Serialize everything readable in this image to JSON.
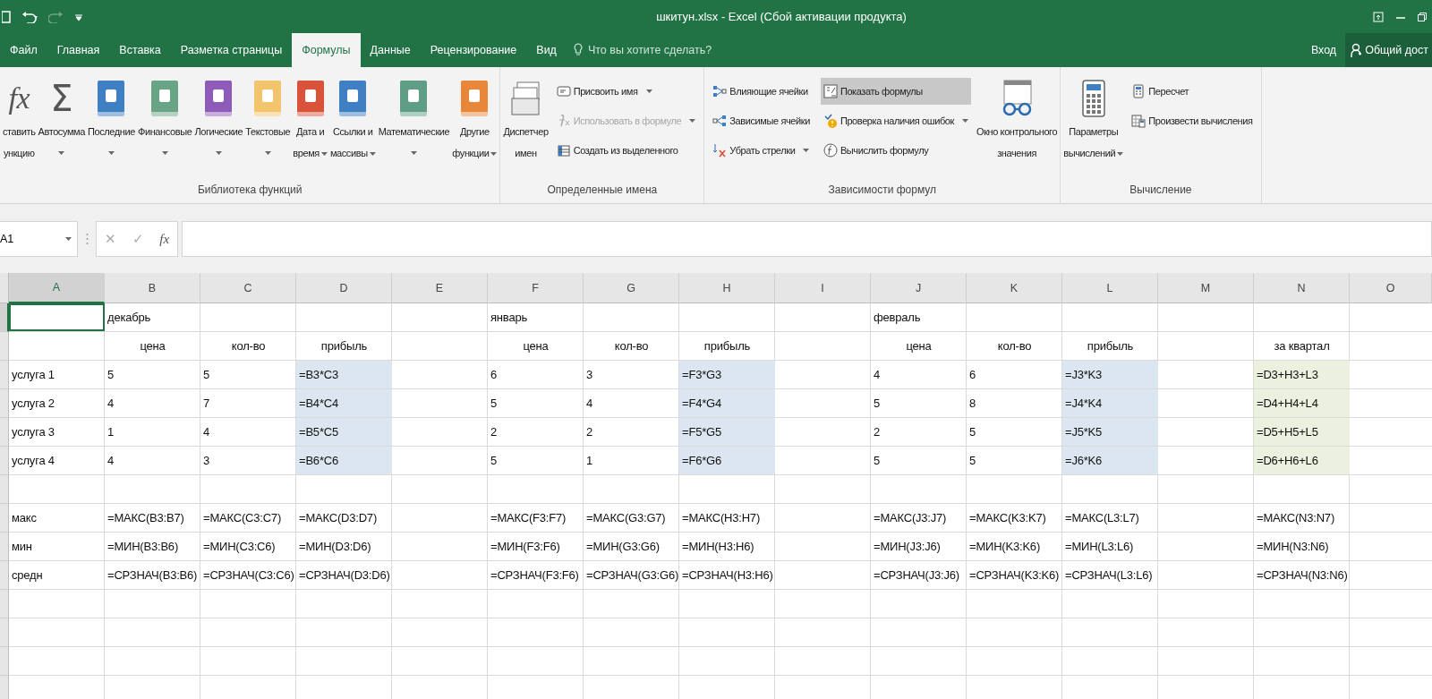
{
  "window": {
    "title": "шкитун.xlsx - Excel (Сбой активации продукта)"
  },
  "tabs": [
    {
      "label": "Файл",
      "selected": false
    },
    {
      "label": "Главная",
      "selected": false
    },
    {
      "label": "Вставка",
      "selected": false
    },
    {
      "label": "Разметка страницы",
      "selected": false
    },
    {
      "label": "Формулы",
      "selected": true
    },
    {
      "label": "Данные",
      "selected": false
    },
    {
      "label": "Рецензирование",
      "selected": false
    },
    {
      "label": "Вид",
      "selected": false
    }
  ],
  "tell_me": {
    "placeholder": "Что вы хотите сделать?"
  },
  "account": {
    "sign_in": "Вход",
    "share": "Общий дост"
  },
  "ribbon": {
    "groups": [
      {
        "label": "Библиотека функций",
        "items": [
          {
            "kind": "function",
            "glyph": "fx",
            "lines": [
              "ставить",
              "ункцию"
            ],
            "dropdown": false
          },
          {
            "kind": "sum",
            "glyph": "Σ",
            "lines": [
              "Автосумма"
            ],
            "dropdown": true
          },
          {
            "kind": "book",
            "color": "#3f7fc4",
            "lines": [
              "Последние"
            ],
            "dropdown": true
          },
          {
            "kind": "book",
            "color": "#6aa487",
            "lines": [
              "Финансовые"
            ],
            "dropdown": true
          },
          {
            "kind": "book",
            "color": "#8e5cb8",
            "lines": [
              "Логические"
            ],
            "dropdown": true
          },
          {
            "kind": "book",
            "color": "#f2c46b",
            "lines": [
              "Текстовые"
            ],
            "dropdown": true
          },
          {
            "kind": "book",
            "color": "#d9533b",
            "lines": [
              "Дата и",
              "время"
            ],
            "dropdown": true
          },
          {
            "kind": "book",
            "color": "#3f7fc4",
            "lines": [
              "Ссылки и",
              "массивы"
            ],
            "dropdown": true
          },
          {
            "kind": "book",
            "color": "#5e9e86",
            "lines": [
              "Математические"
            ],
            "dropdown": true
          },
          {
            "kind": "book",
            "color": "#e8873a",
            "lines": [
              "Другие",
              "функции"
            ],
            "dropdown": true
          }
        ]
      },
      {
        "label": "Определенные имена",
        "items": [
          {
            "kind": "manager",
            "lines": [
              "Диспетчер",
              "имен"
            ],
            "dropdown": false
          },
          {
            "kind": "stack",
            "items": [
              {
                "kind": "assign",
                "label": "Присвоить имя",
                "dropdown": true,
                "disabled": false,
                "selected": false
              },
              {
                "kind": "use",
                "label": "Использовать в формуле",
                "dropdown": true,
                "disabled": true,
                "selected": false
              },
              {
                "kind": "create",
                "label": "Создать из выделенного",
                "dropdown": false,
                "disabled": false,
                "selected": false
              }
            ]
          }
        ]
      },
      {
        "label": "Зависимости формул",
        "items": [
          {
            "kind": "stack",
            "items": [
              {
                "kind": "precedents",
                "label": "Влияющие ячейки",
                "dropdown": false,
                "disabled": false,
                "selected": false
              },
              {
                "kind": "dependents",
                "label": "Зависимые ячейки",
                "dropdown": false,
                "disabled": false,
                "selected": false
              },
              {
                "kind": "remove",
                "label": "Убрать стрелки",
                "dropdown": true,
                "disabled": false,
                "selected": false
              }
            ]
          },
          {
            "kind": "stack",
            "items": [
              {
                "kind": "show",
                "label": "Показать формулы",
                "dropdown": false,
                "disabled": false,
                "selected": true
              },
              {
                "kind": "check",
                "label": "Проверка наличия ошибок",
                "dropdown": true,
                "disabled": false,
                "selected": false
              },
              {
                "kind": "evaluate",
                "label": "Вычислить формулу",
                "dropdown": false,
                "disabled": false,
                "selected": false
              }
            ]
          },
          {
            "kind": "watch",
            "lines": [
              "Окно контрольного",
              "значения"
            ],
            "dropdown": false
          }
        ]
      },
      {
        "label": "Вычисление",
        "items": [
          {
            "kind": "calc",
            "lines": [
              "Параметры",
              "вычислений"
            ],
            "dropdown": true
          },
          {
            "kind": "stack",
            "items": [
              {
                "kind": "recalc",
                "label": "Пересчет",
                "dropdown": false,
                "disabled": false,
                "selected": false
              },
              {
                "kind": "compute",
                "label": "Произвести вычисления",
                "dropdown": false,
                "disabled": false,
                "selected": false
              }
            ]
          }
        ]
      }
    ]
  },
  "formula_bar": {
    "name_box": "A1",
    "cancel": "✕",
    "enter": "✓",
    "fx": "fx"
  },
  "grid": {
    "columns": [
      {
        "label": "A",
        "selected": true
      },
      {
        "label": "B",
        "selected": false
      },
      {
        "label": "C",
        "selected": false
      },
      {
        "label": "D",
        "selected": false
      },
      {
        "label": "E",
        "selected": false
      },
      {
        "label": "F",
        "selected": false
      },
      {
        "label": "G",
        "selected": false
      },
      {
        "label": "H",
        "selected": false
      },
      {
        "label": "I",
        "selected": false
      },
      {
        "label": "J",
        "selected": false
      },
      {
        "label": "K",
        "selected": false
      },
      {
        "label": "L",
        "selected": false
      },
      {
        "label": "M",
        "selected": false
      },
      {
        "label": "N",
        "selected": false
      },
      {
        "label": "O",
        "selected": false
      }
    ],
    "rows": [
      {
        "selected": true,
        "kind": "plain",
        "cells": [
          null,
          {
            "text": "декабрь"
          },
          null,
          null,
          null,
          {
            "text": "январь"
          },
          null,
          null,
          null,
          {
            "text": "февраль"
          },
          null,
          null,
          null,
          null,
          null
        ]
      },
      {
        "selected": false,
        "kind": "header",
        "cells": [
          null,
          {
            "text": "цена"
          },
          {
            "text": "кол-во"
          },
          {
            "text": "прибыль"
          },
          null,
          {
            "text": "цена"
          },
          {
            "text": "кол-во"
          },
          {
            "text": "прибыль"
          },
          null,
          {
            "text": "цена"
          },
          {
            "text": "кол-во"
          },
          {
            "text": "прибыль"
          },
          null,
          {
            "text": "за квартал"
          },
          null
        ]
      },
      {
        "selected": false,
        "kind": "plain",
        "cells": [
          {
            "text": "услуга 1"
          },
          {
            "text": "5"
          },
          {
            "text": "5"
          },
          {
            "text": "=B3*C3",
            "color": "#dce6f1"
          },
          null,
          {
            "text": "6"
          },
          {
            "text": "3"
          },
          {
            "text": "=F3*G3",
            "color": "#dce6f1"
          },
          null,
          {
            "text": "4"
          },
          {
            "text": "6"
          },
          {
            "text": "=J3*K3",
            "color": "#dce6f1"
          },
          null,
          {
            "text": "=D3+H3+L3",
            "color": "#ebf1de"
          },
          null
        ]
      },
      {
        "selected": false,
        "kind": "plain",
        "cells": [
          {
            "text": "услуга 2"
          },
          {
            "text": "4"
          },
          {
            "text": "7"
          },
          {
            "text": "=B4*C4",
            "color": "#dce6f1"
          },
          null,
          {
            "text": "5"
          },
          {
            "text": "4"
          },
          {
            "text": "=F4*G4",
            "color": "#dce6f1"
          },
          null,
          {
            "text": "5"
          },
          {
            "text": "8"
          },
          {
            "text": "=J4*K4",
            "color": "#dce6f1"
          },
          null,
          {
            "text": "=D4+H4+L4",
            "color": "#ebf1de"
          },
          null
        ]
      },
      {
        "selected": false,
        "kind": "plain",
        "cells": [
          {
            "text": "услуга 3"
          },
          {
            "text": "1"
          },
          {
            "text": "4"
          },
          {
            "text": "=B5*C5",
            "color": "#dce6f1"
          },
          null,
          {
            "text": "2"
          },
          {
            "text": "2"
          },
          {
            "text": "=F5*G5",
            "color": "#dce6f1"
          },
          null,
          {
            "text": "2"
          },
          {
            "text": "5"
          },
          {
            "text": "=J5*K5",
            "color": "#dce6f1"
          },
          null,
          {
            "text": "=D5+H5+L5",
            "color": "#ebf1de"
          },
          null
        ]
      },
      {
        "selected": false,
        "kind": "plain",
        "cells": [
          {
            "text": "услуга 4"
          },
          {
            "text": "4"
          },
          {
            "text": "3"
          },
          {
            "text": "=B6*C6",
            "color": "#dce6f1"
          },
          null,
          {
            "text": "5"
          },
          {
            "text": "1"
          },
          {
            "text": "=F6*G6",
            "color": "#dce6f1"
          },
          null,
          {
            "text": "5"
          },
          {
            "text": "5"
          },
          {
            "text": "=J6*K6",
            "color": "#dce6f1"
          },
          null,
          {
            "text": "=D6+H6+L6",
            "color": "#ebf1de"
          },
          null
        ]
      },
      {
        "selected": false,
        "kind": "plain",
        "cells": [
          null,
          null,
          null,
          null,
          null,
          null,
          null,
          null,
          null,
          null,
          null,
          null,
          null,
          null,
          null
        ]
      },
      {
        "selected": false,
        "kind": "plain",
        "cells": [
          {
            "text": "макс"
          },
          {
            "text": "=МАКС(B3:B7)"
          },
          {
            "text": "=МАКС(C3:C7)"
          },
          {
            "text": "=МАКС(D3:D7)"
          },
          null,
          {
            "text": "=МАКС(F3:F7)"
          },
          {
            "text": "=МАКС(G3:G7)"
          },
          {
            "text": "=МАКС(H3:H7)"
          },
          null,
          {
            "text": "=МАКС(J3:J7)"
          },
          {
            "text": "=МАКС(K3:K7)"
          },
          {
            "text": "=МАКС(L3:L7)"
          },
          null,
          {
            "text": "=МАКС(N3:N7)"
          },
          null
        ]
      },
      {
        "selected": false,
        "kind": "plain",
        "cells": [
          {
            "text": "мин"
          },
          {
            "text": "=МИН(B3:B6)"
          },
          {
            "text": "=МИН(C3:C6)"
          },
          {
            "text": "=МИН(D3:D6)"
          },
          null,
          {
            "text": "=МИН(F3:F6)"
          },
          {
            "text": "=МИН(G3:G6)"
          },
          {
            "text": "=МИН(H3:H6)"
          },
          null,
          {
            "text": "=МИН(J3:J6)"
          },
          {
            "text": "=МИН(K3:K6)"
          },
          {
            "text": "=МИН(L3:L6)"
          },
          null,
          {
            "text": "=МИН(N3:N6)"
          },
          null
        ]
      },
      {
        "selected": false,
        "kind": "plain",
        "cells": [
          {
            "text": "средн"
          },
          {
            "text": "=СРЗНАЧ(B3:B6)"
          },
          {
            "text": "=СРЗНАЧ(C3:C6)"
          },
          {
            "text": "=СРЗНАЧ(D3:D6)"
          },
          null,
          {
            "text": "=СРЗНАЧ(F3:F6)"
          },
          {
            "text": "=СРЗНАЧ(G3:G6)"
          },
          {
            "text": "=СРЗНАЧ(H3:H6)"
          },
          null,
          {
            "text": "=СРЗНАЧ(J3:J6)"
          },
          {
            "text": "=СРЗНАЧ(K3:K6)"
          },
          {
            "text": "=СРЗНАЧ(L3:L6)"
          },
          null,
          {
            "text": "=СРЗНАЧ(N3:N6)"
          },
          null
        ]
      },
      {
        "selected": false,
        "kind": "plain",
        "cells": [
          null,
          null,
          null,
          null,
          null,
          null,
          null,
          null,
          null,
          null,
          null,
          null,
          null,
          null,
          null
        ]
      },
      {
        "selected": false,
        "kind": "plain",
        "cells": [
          null,
          null,
          null,
          null,
          null,
          null,
          null,
          null,
          null,
          null,
          null,
          null,
          null,
          null,
          null
        ]
      },
      {
        "selected": false,
        "kind": "plain",
        "cells": [
          null,
          null,
          null,
          null,
          null,
          null,
          null,
          null,
          null,
          null,
          null,
          null,
          null,
          null,
          null
        ]
      }
    ]
  }
}
